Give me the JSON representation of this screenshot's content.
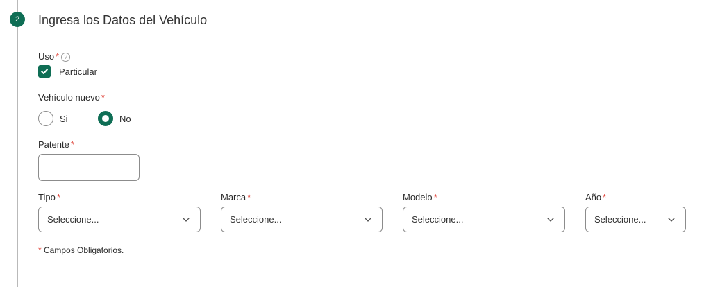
{
  "step": {
    "number": "2",
    "title": "Ingresa los Datos del Vehículo"
  },
  "uso": {
    "label": "Uso",
    "required_mark": "*",
    "help_icon": "?",
    "option_label": "Particular",
    "checked": true
  },
  "vehiculo_nuevo": {
    "label": "Vehículo nuevo",
    "required_mark": "*",
    "options": [
      {
        "label": "Si",
        "selected": false
      },
      {
        "label": "No",
        "selected": true
      }
    ]
  },
  "patente": {
    "label": "Patente",
    "required_mark": "*",
    "value": "",
    "placeholder": ""
  },
  "selects": {
    "tipo": {
      "label": "Tipo",
      "required_mark": "*",
      "value": "Seleccione..."
    },
    "marca": {
      "label": "Marca",
      "required_mark": "*",
      "value": "Seleccione..."
    },
    "modelo": {
      "label": "Modelo",
      "required_mark": "*",
      "value": "Seleccione..."
    },
    "anio": {
      "label": "Año",
      "required_mark": "*",
      "value": "Seleccione..."
    }
  },
  "footnote": {
    "required_mark": "*",
    "text": " Campos Obligatorios."
  },
  "colors": {
    "accent": "#0f6e55",
    "required": "#e0453b",
    "border": "#8c8c8c"
  },
  "icons": {
    "checkbox": "check-icon",
    "select": "chevron-down-icon",
    "help": "question-circle-icon"
  }
}
